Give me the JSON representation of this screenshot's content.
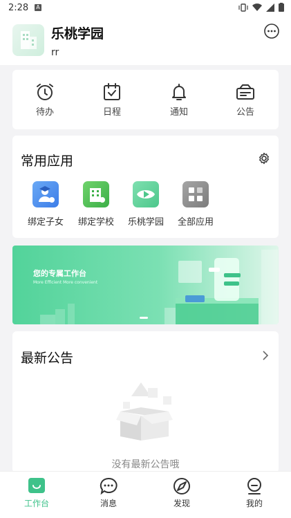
{
  "status_bar": {
    "time": "2:28",
    "notif_letter": "A"
  },
  "header": {
    "school_name": "乐桃学园",
    "user_name": "rr"
  },
  "quick_actions": [
    {
      "label": "待办",
      "icon": "alarm-clock-icon"
    },
    {
      "label": "日程",
      "icon": "calendar-check-icon"
    },
    {
      "label": "通知",
      "icon": "bell-icon"
    },
    {
      "label": "公告",
      "icon": "announcement-box-icon"
    }
  ],
  "common_apps": {
    "title": "常用应用",
    "items": [
      {
        "label": "绑定子女",
        "icon": "bind-child-icon",
        "color": "#4a8ff0"
      },
      {
        "label": "绑定学校",
        "icon": "bind-school-icon",
        "color": "#4fc25a"
      },
      {
        "label": "乐桃学园",
        "icon": "letao-play-icon",
        "color": "#5fd49b"
      },
      {
        "label": "全部应用",
        "icon": "all-apps-icon",
        "color": "#8c8c8c"
      }
    ]
  },
  "banner": {
    "title": "您的专属工作台",
    "subtitle": "More Efficient  More convenient"
  },
  "notices": {
    "title": "最新公告",
    "empty_text": "没有最新公告哦"
  },
  "tabbar": [
    {
      "label": "工作台",
      "icon": "workbench-icon",
      "active": true
    },
    {
      "label": "消息",
      "icon": "message-icon",
      "active": false
    },
    {
      "label": "发现",
      "icon": "discover-icon",
      "active": false
    },
    {
      "label": "我的",
      "icon": "profile-icon",
      "active": false
    }
  ],
  "colors": {
    "accent": "#3ec28a",
    "banner_green": "#52d39a"
  }
}
